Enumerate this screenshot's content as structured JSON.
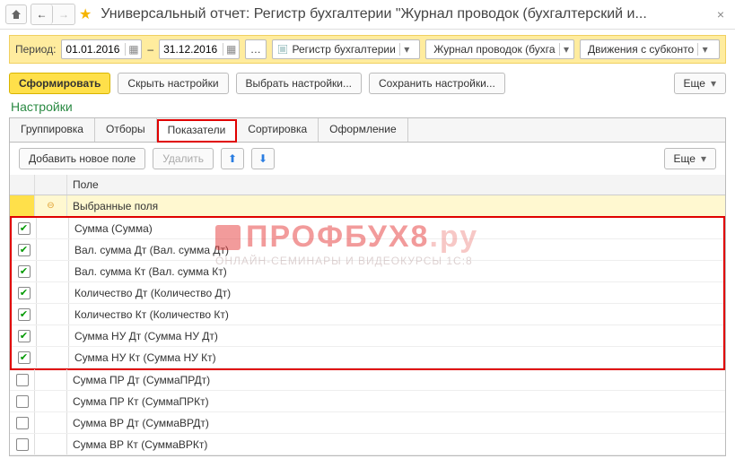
{
  "titlebar": {
    "title": "Универсальный отчет: Регистр бухгалтерии \"Журнал проводок (бухгалтерский и..."
  },
  "period": {
    "label": "Период:",
    "from": "01.01.2016",
    "dash": "–",
    "to": "31.12.2016",
    "register_type": "Регистр бухгалтерии",
    "journal": "Журнал проводок (бухга",
    "movements": "Движения с субконто"
  },
  "toolbar": {
    "run": "Сформировать",
    "hide": "Скрыть настройки",
    "choose": "Выбрать настройки...",
    "save": "Сохранить настройки...",
    "more": "Еще"
  },
  "settings_title": "Настройки",
  "tabs": {
    "grouping": "Группировка",
    "filters": "Отборы",
    "indicators": "Показатели",
    "sorting": "Сортировка",
    "styling": "Оформление"
  },
  "subbar": {
    "add": "Добавить новое поле",
    "delete": "Удалить",
    "more": "Еще"
  },
  "grid": {
    "header": "Поле",
    "group": "Выбранные поля",
    "rows": [
      {
        "checked": true,
        "label": "Сумма (Сумма)"
      },
      {
        "checked": true,
        "label": "Вал. сумма Дт (Вал. сумма Дт)"
      },
      {
        "checked": true,
        "label": "Вал. сумма Кт (Вал. сумма Кт)"
      },
      {
        "checked": true,
        "label": "Количество Дт (Количество Дт)"
      },
      {
        "checked": true,
        "label": "Количество Кт (Количество Кт)"
      },
      {
        "checked": true,
        "label": "Сумма НУ Дт (Сумма НУ Дт)"
      },
      {
        "checked": true,
        "label": "Сумма НУ Кт (Сумма НУ Кт)"
      },
      {
        "checked": false,
        "label": "Сумма ПР Дт (СуммаПРДт)"
      },
      {
        "checked": false,
        "label": "Сумма ПР Кт (СуммаПРКт)"
      },
      {
        "checked": false,
        "label": "Сумма ВР Дт (СуммаВРДт)"
      },
      {
        "checked": false,
        "label": "Сумма ВР Кт (СуммаВРКт)"
      }
    ]
  },
  "watermark": {
    "brand": "ПРОФБУХ8",
    "domain": ".ру",
    "tagline": "ОНЛАЙН-СЕМИНАРЫ И ВИДЕОКУРСЫ 1С:8"
  }
}
